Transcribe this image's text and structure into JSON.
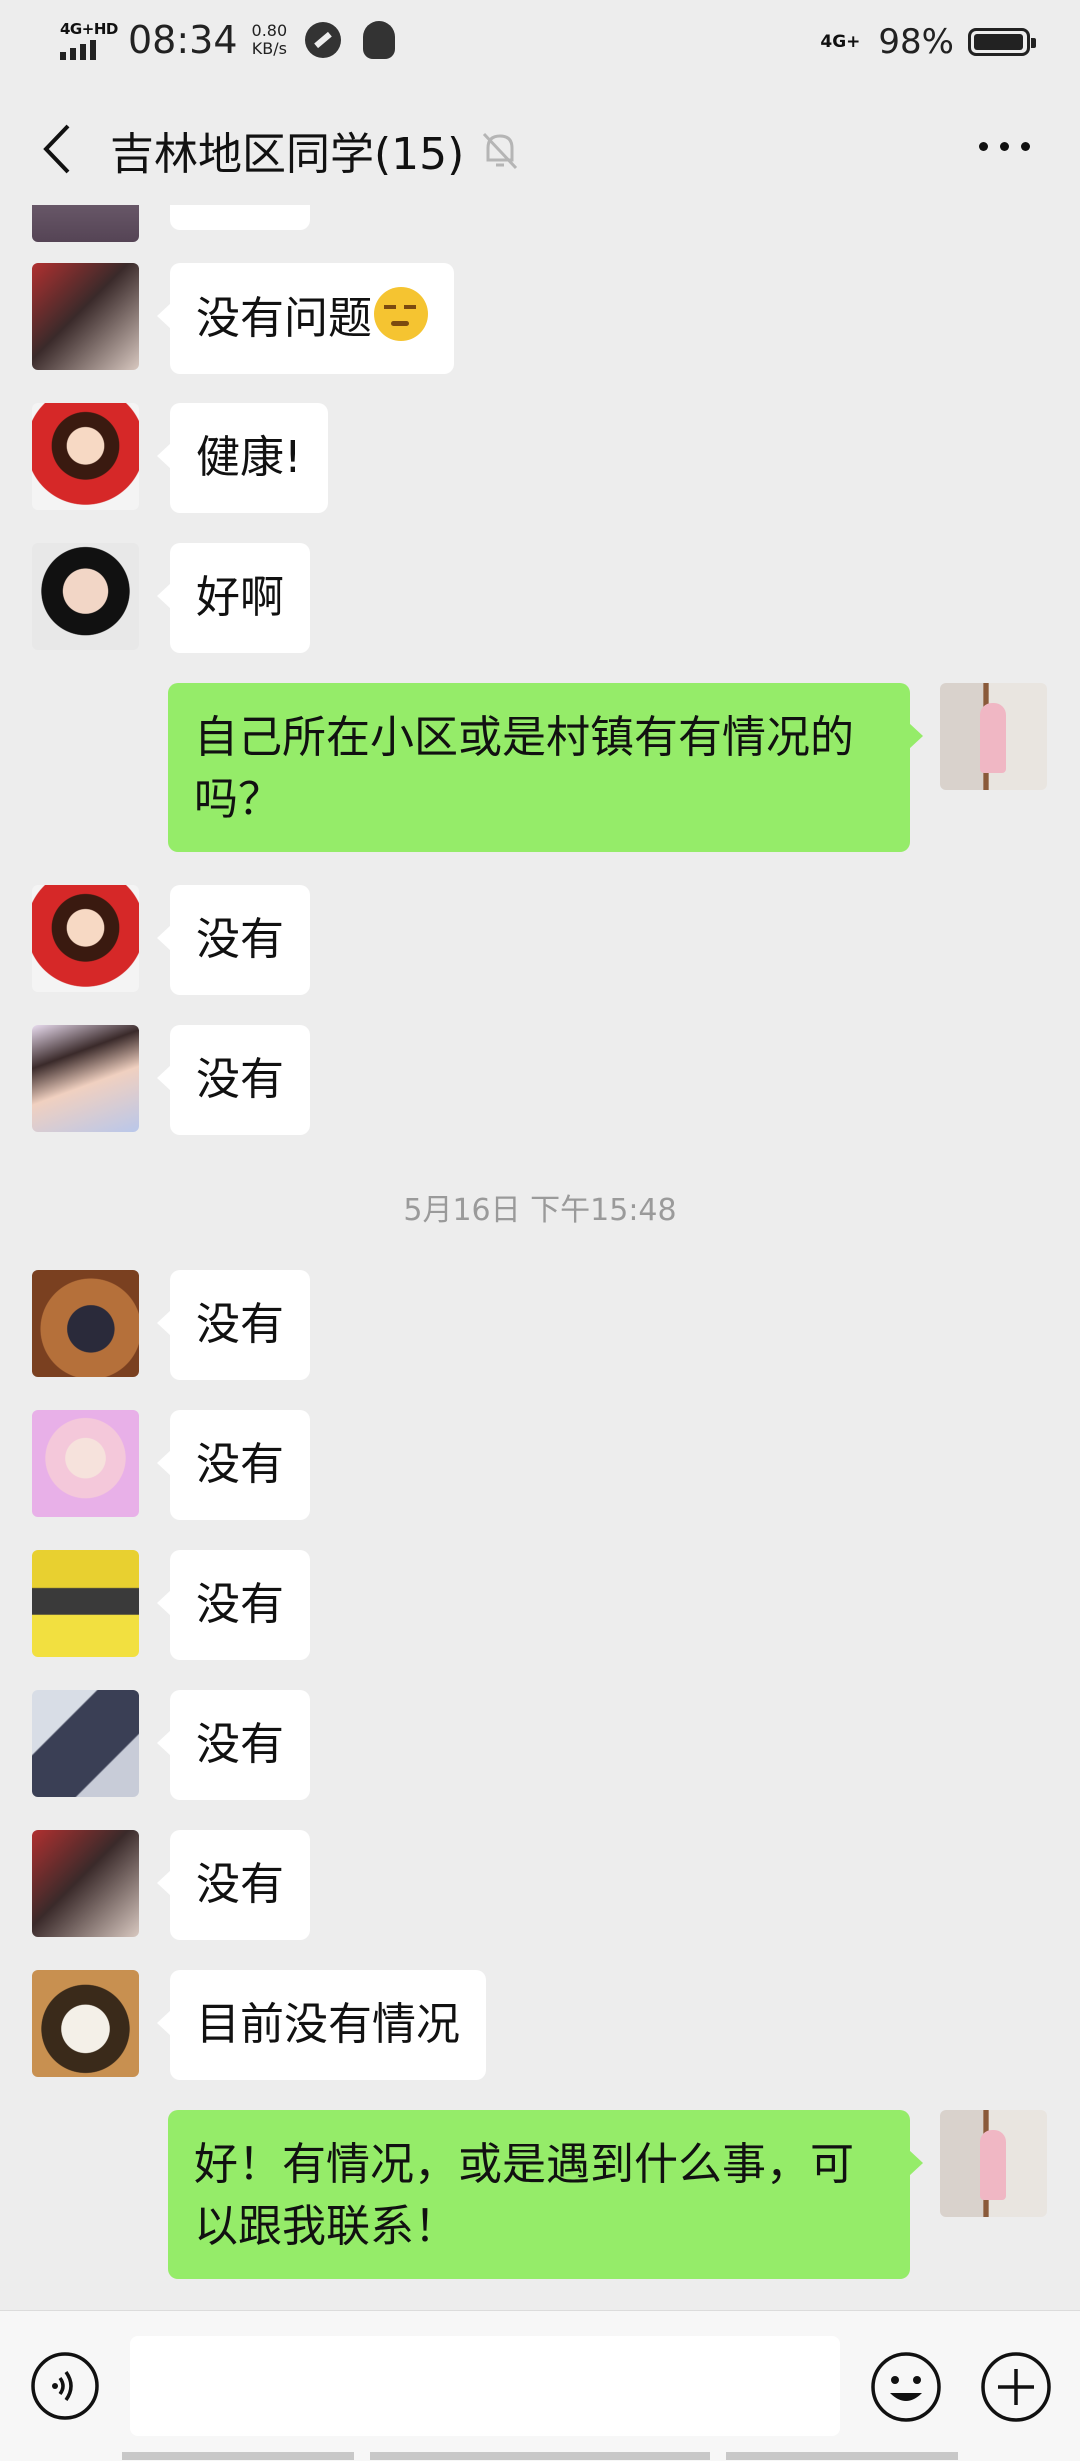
{
  "status_bar": {
    "network_left": "4G+HD",
    "time": "08:34",
    "speed_value": "0.80",
    "speed_unit": "KB/s",
    "network_right": "4G+",
    "battery": "98%",
    "battery_level": 0.98
  },
  "header": {
    "title": "吉林地区同学(15)",
    "back_icon": "chevron-left-icon",
    "mute_icon": "bell-off-icon",
    "more_icon": "more-dots-icon"
  },
  "messages": [
    {
      "side": "left",
      "text": "没有问题",
      "emoji": "smirk-emoji",
      "avatar": "avatar-girl-cola"
    },
    {
      "side": "left",
      "text": "健康!",
      "avatar": "avatar-cartoon-girl"
    },
    {
      "side": "left",
      "text": "好啊",
      "avatar": "avatar-smiling-woman"
    },
    {
      "side": "right",
      "text": "自己所在小区或是村镇有有情况的吗？",
      "avatar": "avatar-self-child"
    },
    {
      "side": "left",
      "text": "没有",
      "avatar": "avatar-cartoon-girl"
    },
    {
      "side": "left",
      "text": "没有",
      "avatar": "avatar-child-photo"
    },
    {
      "side": "left",
      "text": "没有",
      "avatar": "avatar-dark-portrait"
    },
    {
      "side": "left",
      "text": "没有",
      "avatar": "avatar-pink-girl"
    },
    {
      "side": "left",
      "text": "没有",
      "avatar": "avatar-yellow-hat"
    },
    {
      "side": "left",
      "text": "没有",
      "avatar": "avatar-anime-swordsman"
    },
    {
      "side": "left",
      "text": "没有",
      "avatar": "avatar-girl-cola"
    },
    {
      "side": "left",
      "text": "目前没有情况",
      "avatar": "avatar-dog"
    },
    {
      "side": "right",
      "text": "好！有情况，或是遇到什么事，可以跟我联系！",
      "avatar": "avatar-self-child"
    }
  ],
  "timestamp": "5月16日 下午15:48",
  "input_bar": {
    "voice_icon": "voice-icon",
    "emoji_icon": "emoji-face-icon",
    "plus_icon": "plus-circle-icon",
    "text_value": ""
  }
}
